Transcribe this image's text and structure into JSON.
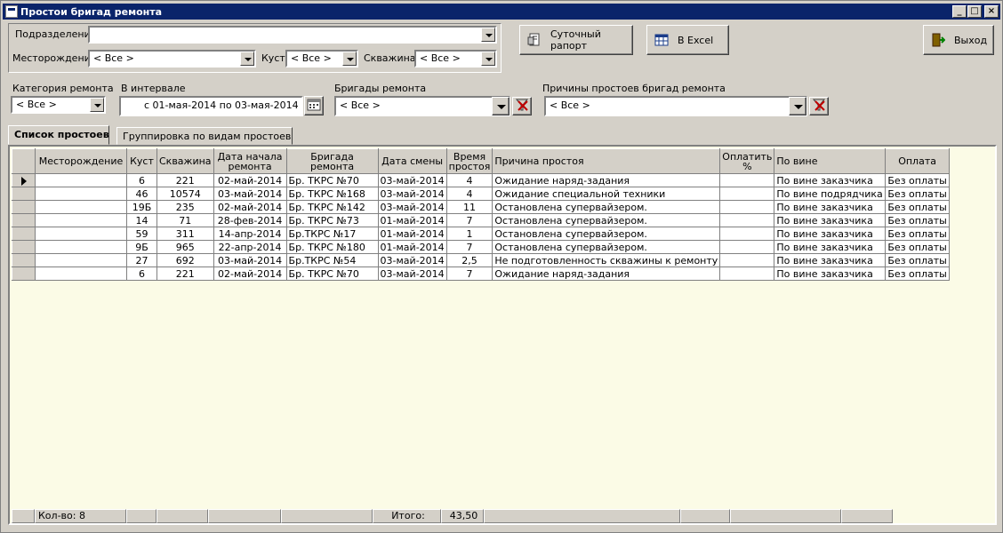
{
  "window": {
    "title": "Простои бригад ремонта",
    "min": "_",
    "max": "□",
    "close": "×"
  },
  "filters": {
    "podrazdelenie_label": "Подразделение",
    "podrazdelenie_value": "",
    "mestorozhdenie_label": "Месторождение",
    "mestorozhdenie_value": "< Все >",
    "kust_label": "Куст",
    "kust_value": "< Все >",
    "skvazhina_label": "Скважина",
    "skvazhina_value": "< Все >",
    "kategoria_label": "Категория ремонта",
    "kategoria_value": "< Все >",
    "interval_label": "В интервале",
    "interval_value": "с 01-мая-2014 по 03-мая-2014",
    "brigady_label": "Бригады ремонта",
    "brigady_value": "< Все >",
    "prichiny_label": "Причины простоев бригад ремонта",
    "prichiny_value": "< Все >"
  },
  "buttons": {
    "report": "Суточный рапорт",
    "excel": "В Excel",
    "exit": "Выход"
  },
  "tabs": [
    "Список простоев",
    "Группировка по видам простоев"
  ],
  "grid": {
    "columns": [
      "Месторождение",
      "Куст",
      "Скважина",
      "Дата начала ремонта",
      "Бригада ремонта",
      "Дата смены",
      "Время простоя",
      "Причина простоя",
      "Оплатить %",
      "По вине",
      "Оплата"
    ],
    "rows": [
      [
        "",
        "6",
        "221",
        "02-май-2014",
        "Бр. ТКРС №70",
        "03-май-2014",
        "4",
        "Ожидание наряд-задания",
        "",
        "По вине заказчика",
        "Без оплаты"
      ],
      [
        "",
        "46",
        "10574",
        "03-май-2014",
        "Бр. ТКРС №168",
        "03-май-2014",
        "4",
        "Ожидание специальной техники",
        "",
        "По вине подрядчика",
        "Без оплаты"
      ],
      [
        "",
        "19Б",
        "235",
        "02-май-2014",
        "Бр. ТКРС №142",
        "03-май-2014",
        "11",
        "Остановлена супервайзером.",
        "",
        "По вине заказчика",
        "Без оплаты"
      ],
      [
        "",
        "14",
        "71",
        "28-фев-2014",
        "Бр. ТКРС №73",
        "01-май-2014",
        "7",
        "Остановлена супервайзером.",
        "",
        "По вине заказчика",
        "Без оплаты"
      ],
      [
        "",
        "59",
        "311",
        "14-апр-2014",
        "Бр.ТКРС №17",
        "01-май-2014",
        "1",
        "Остановлена супервайзером.",
        "",
        "По вине заказчика",
        "Без оплаты"
      ],
      [
        "",
        "9Б",
        "965",
        "22-апр-2014",
        "Бр. ТКРС №180",
        "01-май-2014",
        "7",
        "Остановлена супервайзером.",
        "",
        "По вине заказчика",
        "Без оплаты"
      ],
      [
        "",
        "27",
        "692",
        "03-май-2014",
        "Бр.ТКРС №54",
        "03-май-2014",
        "2,5",
        "Не подготовленность скважины к ремонту",
        "",
        "По вине заказчика",
        "Без оплаты"
      ],
      [
        "",
        "6",
        "221",
        "02-май-2014",
        "Бр. ТКРС №70",
        "03-май-2014",
        "7",
        "Ожидание наряд-задания",
        "",
        "По вине заказчика",
        "Без оплаты"
      ]
    ],
    "footer": {
      "count": "Кол-во:  8",
      "total_label": "Итого:",
      "total_value": "43,50"
    }
  }
}
